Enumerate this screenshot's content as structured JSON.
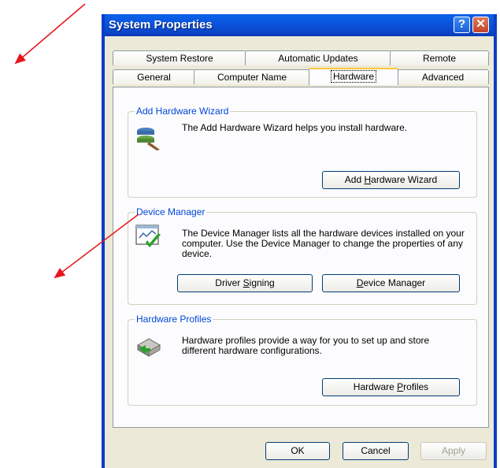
{
  "window": {
    "title": "System Properties"
  },
  "tabs": {
    "row1": [
      "System Restore",
      "Automatic Updates",
      "Remote"
    ],
    "row2": [
      "General",
      "Computer Name",
      "Hardware",
      "Advanced"
    ],
    "active": "Hardware"
  },
  "groups": {
    "add_hw": {
      "title": "Add Hardware Wizard",
      "text": "The Add Hardware Wizard helps you install hardware.",
      "button": {
        "pre": "Add ",
        "key": "H",
        "post": "ardware Wizard"
      }
    },
    "devmgr": {
      "title": "Device Manager",
      "text": "The Device Manager lists all the hardware devices installed on your computer. Use the Device Manager to change the properties of any device.",
      "btn_sign": {
        "pre": "Driver ",
        "key": "S",
        "post": "igning"
      },
      "btn_dm": {
        "pre": "",
        "key": "D",
        "post": "evice Manager"
      }
    },
    "profiles": {
      "title": "Hardware Profiles",
      "text": "Hardware profiles provide a way for you to set up and store different hardware configurations.",
      "button": {
        "pre": "Hardware ",
        "key": "P",
        "post": "rofiles"
      }
    }
  },
  "footer": {
    "ok": "OK",
    "cancel": "Cancel",
    "apply": "Apply"
  },
  "colors": {
    "arrow": "#e8141d",
    "titlebar": "#0A55DE",
    "group_title": "#0046d5",
    "active_tab_accent": "#ffc83c"
  },
  "icons": [
    "help-icon",
    "close-icon",
    "add-hardware-icon",
    "device-manager-icon",
    "hardware-profiles-icon"
  ]
}
